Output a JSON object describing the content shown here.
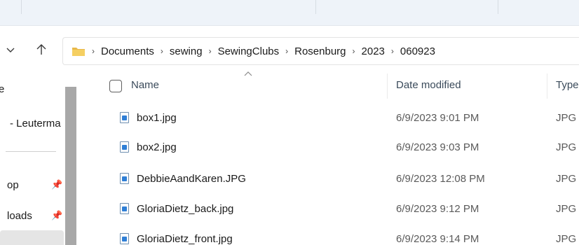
{
  "window": {
    "accent": "#2f7fd6",
    "folder_color": "#e8b84a"
  },
  "toolbar": {
    "back_icon": "chevron-down-icon",
    "up_icon": "arrow-up-icon"
  },
  "address": {
    "folder_icon": "folder-icon",
    "separator": "›",
    "crumbs": [
      "Documents",
      "sewing",
      "SewingClubs",
      "Rosenburg",
      "2023",
      "060923"
    ]
  },
  "nav": {
    "items": [
      {
        "label": "e",
        "pinned": false
      },
      {
        "label": "- Leuterma",
        "pinned": false
      },
      {
        "label": "op",
        "pinned": true
      },
      {
        "label": "loads",
        "pinned": true
      }
    ]
  },
  "columns": {
    "name": "Name",
    "date": "Date modified",
    "type": "Type"
  },
  "files": [
    {
      "name": "box1.jpg",
      "date": "6/9/2023 9:01 PM",
      "type": "JPG"
    },
    {
      "name": "box2.jpg",
      "date": "6/9/2023 9:03 PM",
      "type": "JPG"
    },
    {
      "name": "DebbieAandKaren.JPG",
      "date": "6/9/2023 12:08 PM",
      "type": "JPG"
    },
    {
      "name": "GloriaDietz_back.jpg",
      "date": "6/9/2023 9:12 PM",
      "type": "JPG"
    },
    {
      "name": "GloriaDietz_front.jpg",
      "date": "6/9/2023 9:14 PM",
      "type": "JPG"
    }
  ]
}
